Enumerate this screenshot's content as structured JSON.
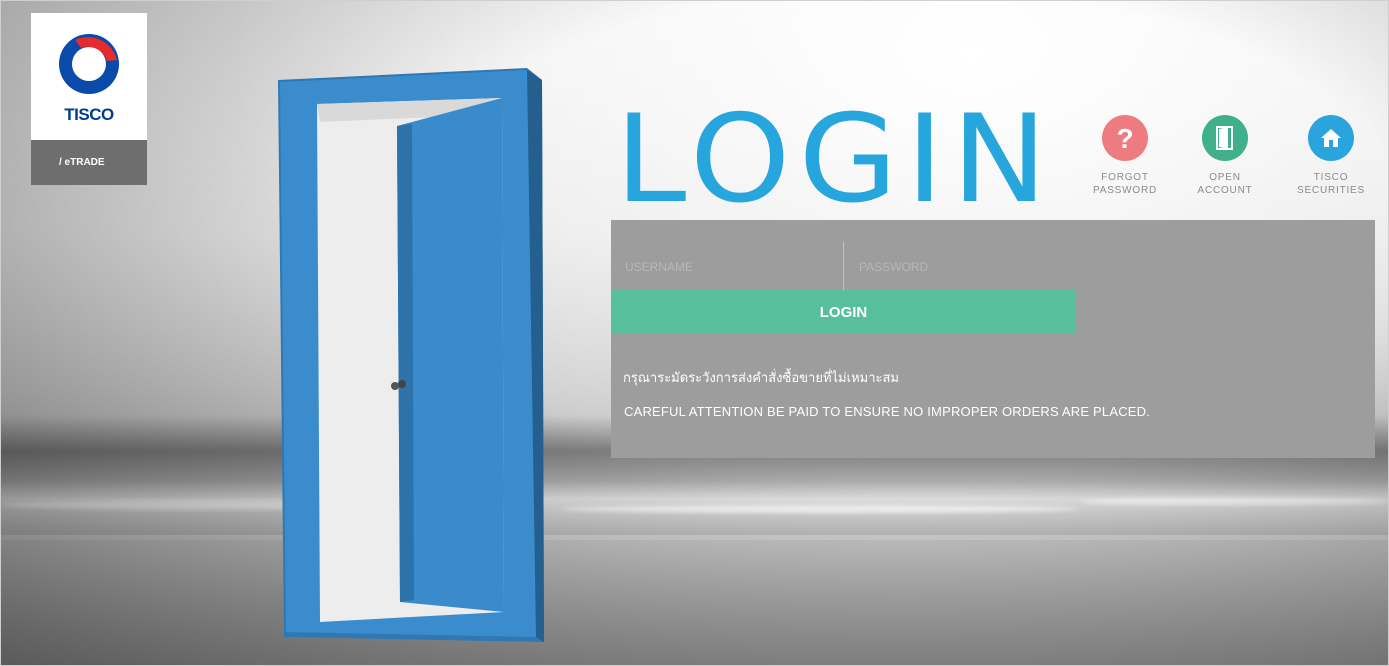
{
  "brand": {
    "logo_text": "TISCO",
    "tab_label": "/ eTRADE"
  },
  "heading": "LOGIN",
  "links": [
    {
      "name": "forgot-password",
      "line1": "FORGOT",
      "line2": "PASSWORD",
      "icon": "question-icon",
      "color": "#ee7b80"
    },
    {
      "name": "open-account",
      "line1": "OPEN",
      "line2": "ACCOUNT",
      "icon": "door-icon",
      "color": "#3fb08b"
    },
    {
      "name": "tisco-securities",
      "line1": "TISCO",
      "line2": "SECURITIES",
      "icon": "home-icon",
      "color": "#2aa4dc"
    }
  ],
  "form": {
    "username_placeholder": "USERNAME",
    "password_placeholder": "PASSWORD",
    "login_label": "LOGIN"
  },
  "notice_thai": "กรุณาระมัดระวังการส่งคำสั่งซื้อขายที่ไม่เหมาะสม",
  "notice_en": "CAREFUL ATTENTION BE PAID TO ENSURE NO IMPROPER ORDERS ARE PLACED.",
  "colors": {
    "accent_blue": "#27a6dd",
    "button_green": "#58bf9d",
    "panel_gray": "#9d9d9d",
    "door_blue": "#3b8ccc"
  }
}
